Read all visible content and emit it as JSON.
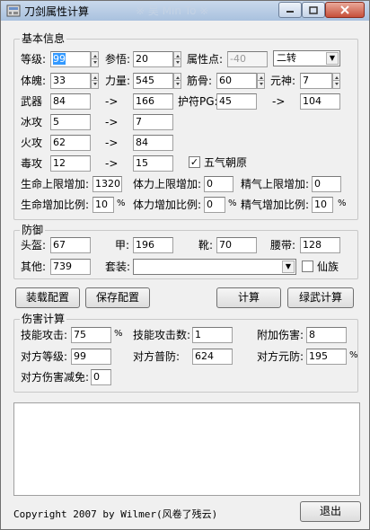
{
  "title": "刀剑属性计算",
  "titlebar_faded": "※ 吴 Min To ※",
  "basic": {
    "legend": "基本信息",
    "level_label": "等级:",
    "level_value": "99",
    "canwu_label": "参悟:",
    "canwu_value": "20",
    "attrpoint_label": "属性点:",
    "attrpoint_value": "-40",
    "zhuan_value": "二转",
    "tipo_label": "体魄:",
    "tipo_value": "33",
    "liliang_label": "力量:",
    "liliang_value": "545",
    "jingu_label": "筋骨:",
    "jingu_value": "60",
    "yuanshen_label": "元神:",
    "yuanshen_value": "7",
    "weapon_label": "武器",
    "weapon_value": "84",
    "weapon_result": "166",
    "arrow": "->",
    "hufu_label": "护符PG:",
    "hufu_value": "45",
    "hufu_result": "104",
    "ice_label": "冰攻",
    "ice_value": "5",
    "ice_result": "7",
    "fire_label": "火攻",
    "fire_value": "62",
    "fire_result": "84",
    "poison_label": "毒攻",
    "poison_value": "12",
    "poison_result": "15",
    "wuqi_label": "五气朝原",
    "wuqi_checked": "✓",
    "hp_add_label": "生命上限增加:",
    "hp_add_value": "1320",
    "sta_add_label": "体力上限增加:",
    "sta_add_value": "0",
    "mp_add_label": "精气上限增加:",
    "mp_add_value": "0",
    "hp_pct_label": "生命增加比例:",
    "hp_pct_value": "10",
    "sta_pct_label": "体力增加比例:",
    "sta_pct_value": "0",
    "mp_pct_label": "精气增加比例:",
    "mp_pct_value": "10",
    "pct": "%"
  },
  "defense": {
    "legend": "防御",
    "helmet_label": "头盔:",
    "helmet_value": "67",
    "armor_label": "甲:",
    "armor_value": "196",
    "boots_label": "靴:",
    "boots_value": "70",
    "belt_label": "腰带:",
    "belt_value": "128",
    "other_label": "其他:",
    "other_value": "739",
    "set_label": "套装:",
    "set_value": "",
    "xianzu_label": "仙族"
  },
  "buttons": {
    "load": "装载配置",
    "save": "保存配置",
    "calc": "计算",
    "lvwu": "绿武计算",
    "exit": "退出"
  },
  "damage": {
    "legend": "伤害计算",
    "skill_atk_label": "技能攻击:",
    "skill_atk_value": "75",
    "skill_cnt_label": "技能攻击数:",
    "skill_cnt_value": "1",
    "extra_label": "附加伤害:",
    "extra_value": "8",
    "enemy_lvl_label": "对方等级:",
    "enemy_lvl_value": "99",
    "enemy_def_label": "对方普防:",
    "enemy_def_value": "624",
    "enemy_yuan_label": "对方元防:",
    "enemy_yuan_value": "195",
    "enemy_red_label": "对方伤害减免:",
    "enemy_red_value": "0",
    "pct": "%"
  },
  "footer": {
    "copyright": "Copyright 2007 by Wilmer(风卷了残云)"
  }
}
